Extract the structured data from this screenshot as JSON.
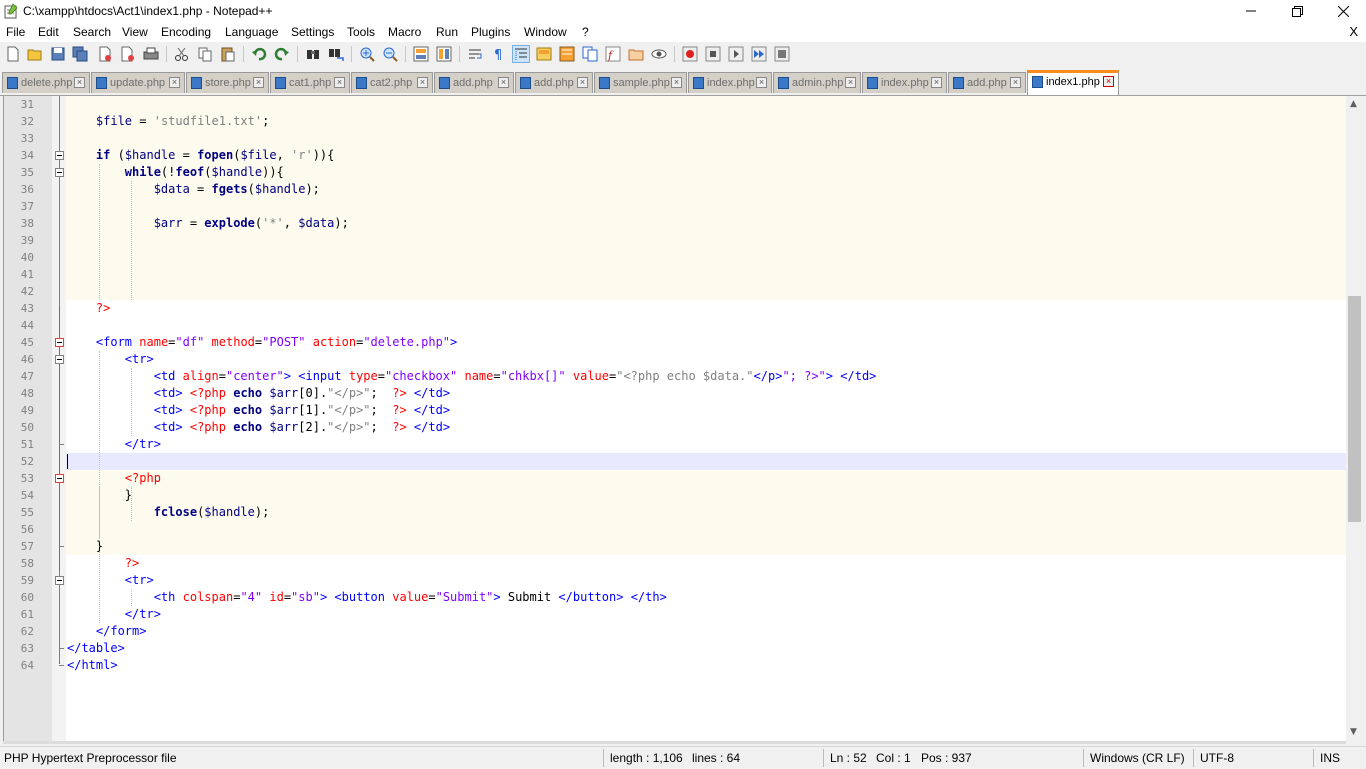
{
  "window": {
    "title": "C:\\xampp\\htdocs\\Act1\\index1.php - Notepad++",
    "icons": [
      "notepadpp-icon",
      "minimize-icon",
      "maximize-icon",
      "close-icon"
    ]
  },
  "menu": {
    "items": [
      "File",
      "Edit",
      "Search",
      "View",
      "Encoding",
      "Language",
      "Settings",
      "Tools",
      "Macro",
      "Run",
      "Plugins",
      "Window",
      "?"
    ],
    "close_label": "X"
  },
  "tabs": [
    {
      "label": "delete.php",
      "active": false
    },
    {
      "label": "update.php",
      "active": false
    },
    {
      "label": "store.php",
      "active": false
    },
    {
      "label": "cat1.php",
      "active": false
    },
    {
      "label": "cat2.php",
      "active": false
    },
    {
      "label": "add.php",
      "active": false
    },
    {
      "label": "add.php",
      "active": false
    },
    {
      "label": "sample.php",
      "active": false
    },
    {
      "label": "index.php",
      "active": false
    },
    {
      "label": "admin.php",
      "active": false
    },
    {
      "label": "index.php",
      "active": false
    },
    {
      "label": "add.php",
      "active": false
    },
    {
      "label": "index1.php",
      "active": true
    }
  ],
  "editor": {
    "line_numbers": [
      "31",
      "32",
      "33",
      "34",
      "35",
      "36",
      "37",
      "38",
      "39",
      "40",
      "41",
      "42",
      "43",
      "44",
      "45",
      "46",
      "47",
      "48",
      "49",
      "50",
      "51",
      "52",
      "53",
      "54",
      "55",
      "56",
      "57",
      "58",
      "59",
      "60",
      "61",
      "62",
      "63",
      "64"
    ],
    "current_line": "52",
    "lines": [
      "",
      "    $file = 'studfile1.txt';",
      "",
      "    if ($handle = fopen($file, 'r')){",
      "        while(!feof($handle)){",
      "            $data = fgets($handle);",
      "",
      "            $arr = explode('*', $data);",
      "",
      "",
      "",
      "",
      "    ?>",
      "",
      "    <form name=\"df\" method=\"POST\" action=\"delete.php\">",
      "        <tr>",
      "            <td align=\"center\"> <input type=\"checkbox\" name=\"chkbx[]\" value=\"<?php echo $data.\"</p>\"; ?>\"> </td>",
      "            <td> <?php echo $arr[0].\"</p>\";  ?> </td>",
      "            <td> <?php echo $arr[1].\"</p>\";  ?> </td>",
      "            <td> <?php echo $arr[2].\"</p>\";  ?> </td>",
      "        </tr>",
      "",
      "        <?php",
      "        }",
      "            fclose($handle);",
      "",
      "    }",
      "        ?>",
      "        <tr>",
      "            <th colspan=\"4\" id=\"sb\"> <button value=\"Submit\"> Submit </button> </th>",
      "        </tr>",
      "    </form>",
      "</table>",
      "</html>"
    ]
  },
  "statusbar": {
    "filetype": "PHP Hypertext Preprocessor file",
    "length": "length : 1,106",
    "lines": "lines : 64",
    "ln": "Ln : 52",
    "col": "Col : 1",
    "pos": "Pos : 937",
    "eol": "Windows (CR LF)",
    "encoding": "UTF-8",
    "mode": "INS"
  },
  "colors": {
    "keyword": "#000080",
    "php_tag": "#ff0000",
    "html_tag": "#0000ff",
    "attr_value": "#8000ff",
    "string": "#808080",
    "active_tab_accent": "#fa8c1e",
    "current_line_bg": "#e8e8ff"
  }
}
